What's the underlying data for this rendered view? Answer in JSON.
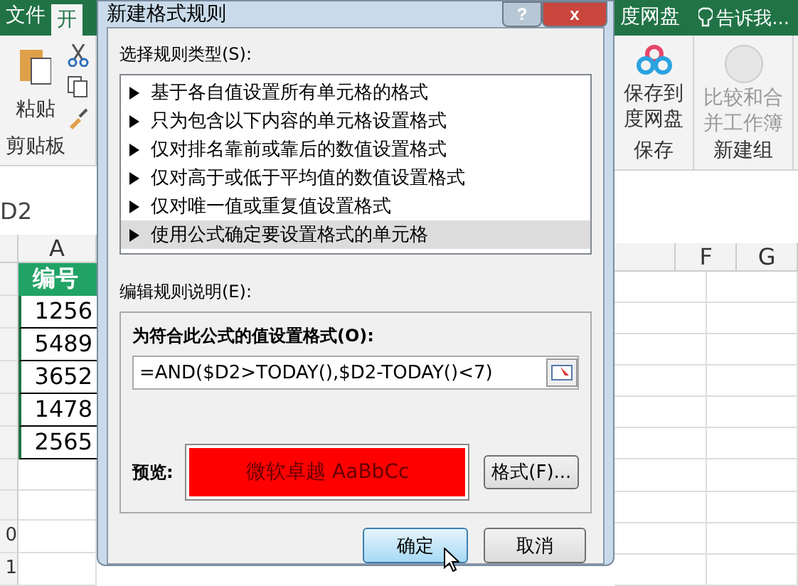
{
  "excel_left": {
    "tabs": [
      {
        "label": "文件",
        "selected": false
      },
      {
        "label": "开",
        "selected": true
      }
    ],
    "paste_label": "粘贴",
    "group_label": "剪贴板",
    "name_box": "D2",
    "column_header": "A",
    "header_cell": "编号",
    "cells": [
      "1256",
      "5489",
      "3652",
      "1478",
      "2565"
    ],
    "row_numbers": [
      "0",
      "1"
    ]
  },
  "dialog": {
    "title": "新建格式规则",
    "help": "?",
    "close": "x",
    "rule_type_label": "选择规则类型(S):",
    "rule_types": [
      {
        "label": "基于各自值设置所有单元格的格式",
        "selected": false
      },
      {
        "label": "只为包含以下内容的单元格设置格式",
        "selected": false
      },
      {
        "label": "仅对排名靠前或靠后的数值设置格式",
        "selected": false
      },
      {
        "label": "仅对高于或低于平均值的数值设置格式",
        "selected": false
      },
      {
        "label": "仅对唯一值或重复值设置格式",
        "selected": false
      },
      {
        "label": "使用公式确定要设置格式的单元格",
        "selected": true
      }
    ],
    "edit_label": "编辑规则说明(E):",
    "formula_label": "为符合此公式的值设置格式(O):",
    "formula": "=AND($D2>TODAY(),$D2-TODAY()<7)",
    "preview_label": "预览:",
    "preview_text": "微软卓越  AaBbCc",
    "format_button": "格式(F)...",
    "ok": "确定",
    "cancel": "取消"
  },
  "excel_right": {
    "tab": "度网盘",
    "tell_me": "告诉我...",
    "groups": [
      {
        "button": "保存到度网盘",
        "label": "保存",
        "kind": "cloud"
      },
      {
        "button": "比较和合并工作簿",
        "label": "新建组",
        "kind": "disabled"
      }
    ],
    "columns": [
      "F",
      "G"
    ]
  }
}
